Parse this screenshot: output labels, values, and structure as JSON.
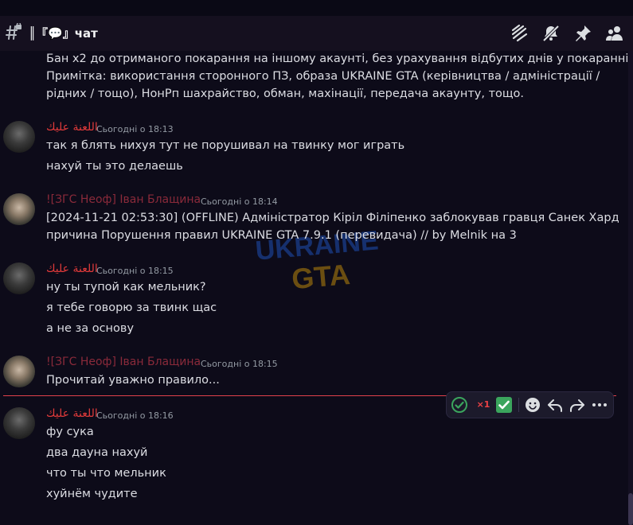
{
  "channel": {
    "name": "║『💬』чат"
  },
  "header_icons": [
    "threads-icon",
    "notifications-muted-icon",
    "pin-icon",
    "members-icon"
  ],
  "messages": {
    "m0": {
      "line1": "Бан x2 до отриманого покарання на іншому акаунті, без урахування відбутих днів у покаранні",
      "line2": "Примітка: використання сторонного ПЗ, образа UKRAINE GTA (керівництва / адміністрації /",
      "line3": "рідних / тощо), НонРп шахрайство, обман, махінації, передача акаунту, тощо."
    },
    "m1": {
      "author": "اللعنة عليك",
      "time": "Сьогодні о 18:13",
      "l1": "так я блять нихуя тут не порушивал на твинку мог играть",
      "l2": "нахуй ты это делаешь"
    },
    "m2": {
      "author": "![ЗГС Неоф] Іван Блащина",
      "time": "Сьогодні о 18:14",
      "l1": "[2024-11-21 02:53:30] (OFFLINE) Адміністратор Кіріл Філіпенко заблокував гравця Санек Хард",
      "l2": "причина Порушення правил UKRAINE GTA 7.9.1 (перевидача) // by Melnik на 3"
    },
    "m3": {
      "author": "اللعنة عليك",
      "time": "Сьогодні о 18:15",
      "l1": "ну ты тупой как мельник?",
      "l2": "я тебе говорю за твинк щас",
      "l3": "а не за основу"
    },
    "m4": {
      "author": "![ЗГС Неоф] Іван Блащина",
      "time": "Сьогодні о 18:15",
      "l1": "Прочитай уважно правило..."
    },
    "m5": {
      "author": "اللعنة عليك",
      "time": "Сьогодні о 18:16",
      "l1": "фу сука",
      "l2": "два дауна нахуй",
      "l3": "что ты что мельник",
      "l4": "хуйнём чудите"
    }
  },
  "watermark": {
    "line1": "UKRAINE",
    "line2": "GTA"
  },
  "toolbar": {
    "reactions": [
      "check-circle-icon",
      "x1-icon",
      "checkmark-box-icon"
    ],
    "actions": [
      "add-reaction-icon",
      "reply-icon",
      "forward-icon",
      "more-icon"
    ],
    "x1_label": "×1"
  },
  "colors": {
    "author_arabic": "#e03a3a",
    "author_ivan": "#8a2a3a",
    "new_messages_line": "#e2424b",
    "background": "#0d0b19"
  }
}
